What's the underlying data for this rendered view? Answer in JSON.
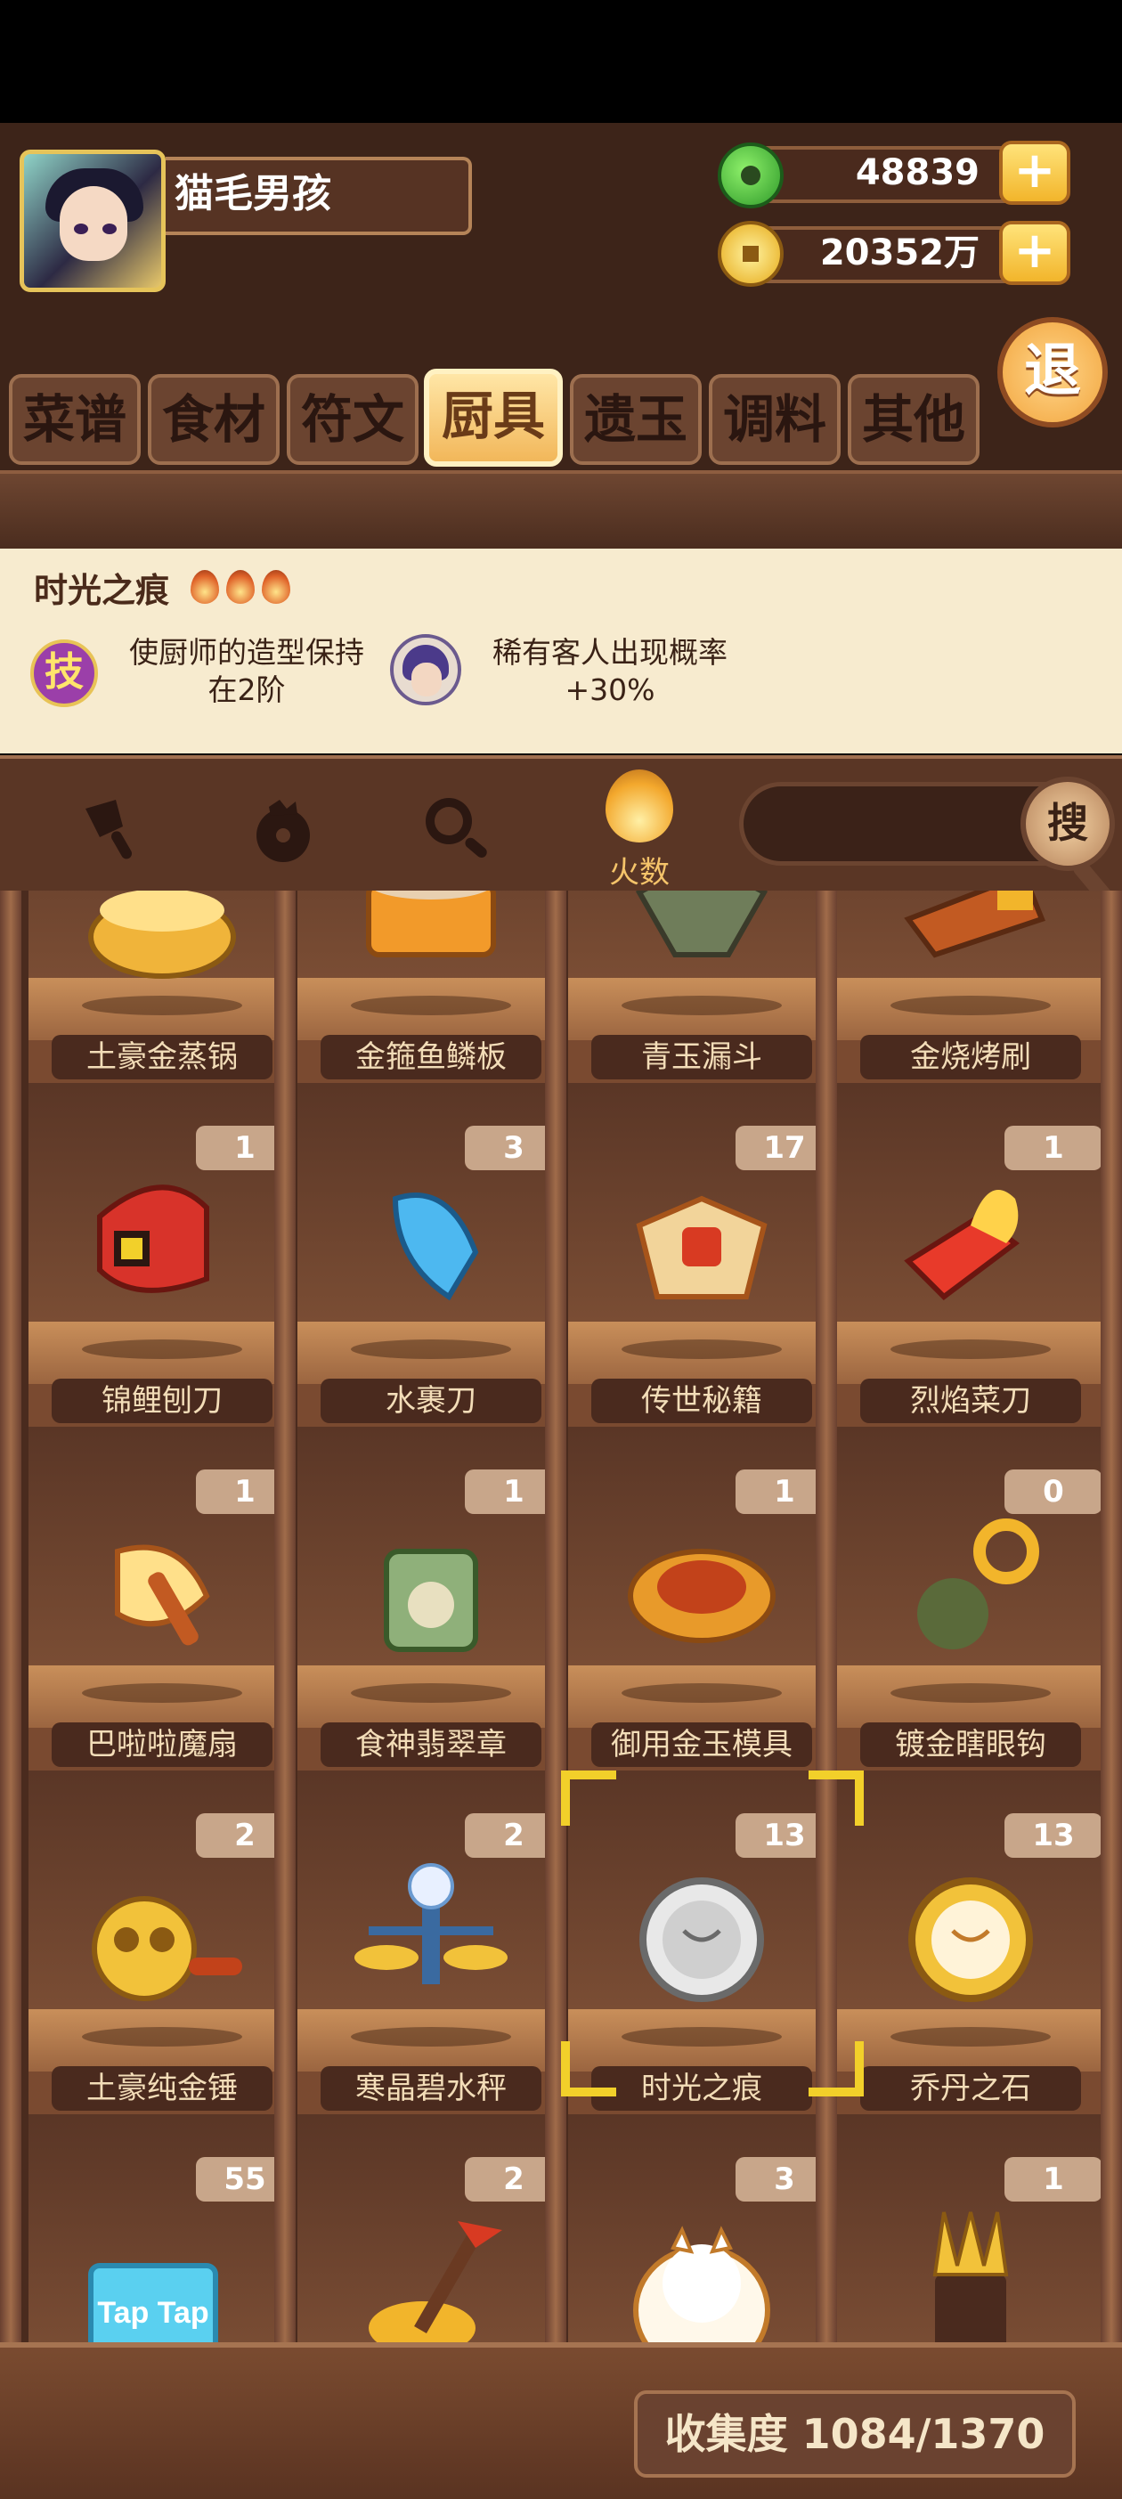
{
  "header": {
    "username": "猫毛男孩",
    "jade_amount": "48839",
    "coin_amount": "20352万",
    "plus_label": "+",
    "exit_label": "退"
  },
  "tabs": [
    {
      "label": "菜谱",
      "active": false
    },
    {
      "label": "食材",
      "active": false
    },
    {
      "label": "符文",
      "active": false
    },
    {
      "label": "厨具",
      "active": true
    },
    {
      "label": "遗玉",
      "active": false
    },
    {
      "label": "调料",
      "active": false
    },
    {
      "label": "其他",
      "active": false
    }
  ],
  "selected_item": {
    "name": "时光之痕",
    "flames": 3,
    "skill_badge": "技",
    "skill_text_line1": "使厨师的造型保持",
    "skill_text_line2": "在2阶",
    "guest_text_line1": "稀有客人出现概率",
    "guest_text_line2": "+30%"
  },
  "filter": {
    "fire_label": "火数",
    "search_label": "搜"
  },
  "items": [
    {
      "name": "土豪金蒸锅",
      "count": ""
    },
    {
      "name": "金箍鱼鳞板",
      "count": ""
    },
    {
      "name": "青玉漏斗",
      "count": ""
    },
    {
      "name": "金烧烤刷",
      "count": ""
    },
    {
      "name": "锦鲤刨刀",
      "count": "1"
    },
    {
      "name": "水裹刀",
      "count": "3"
    },
    {
      "name": "传世秘籍",
      "count": "17"
    },
    {
      "name": "烈焰菜刀",
      "count": "1"
    },
    {
      "name": "巴啦啦魔扇",
      "count": "1"
    },
    {
      "name": "食神翡翠章",
      "count": "1"
    },
    {
      "name": "御用金玉模具",
      "count": "1"
    },
    {
      "name": "镀金瞎眼钩",
      "count": "0"
    },
    {
      "name": "土豪纯金锤",
      "count": "2"
    },
    {
      "name": "寒晶碧水秤",
      "count": "2"
    },
    {
      "name": "时光之痕",
      "count": "13",
      "selected": true
    },
    {
      "name": "乔丹之石",
      "count": "13"
    },
    {
      "name": "",
      "count": "55",
      "stamp_text": "Tap Tap"
    },
    {
      "name": "",
      "count": "2"
    },
    {
      "name": "",
      "count": "3"
    },
    {
      "name": "",
      "count": "1"
    }
  ],
  "footer": {
    "collection_label": "收集度 1084/1370"
  },
  "colors": {
    "selection_bracket": "#f2d02a",
    "tab_active": "#f2b75a",
    "panel_bg": "#f7ebcf"
  }
}
